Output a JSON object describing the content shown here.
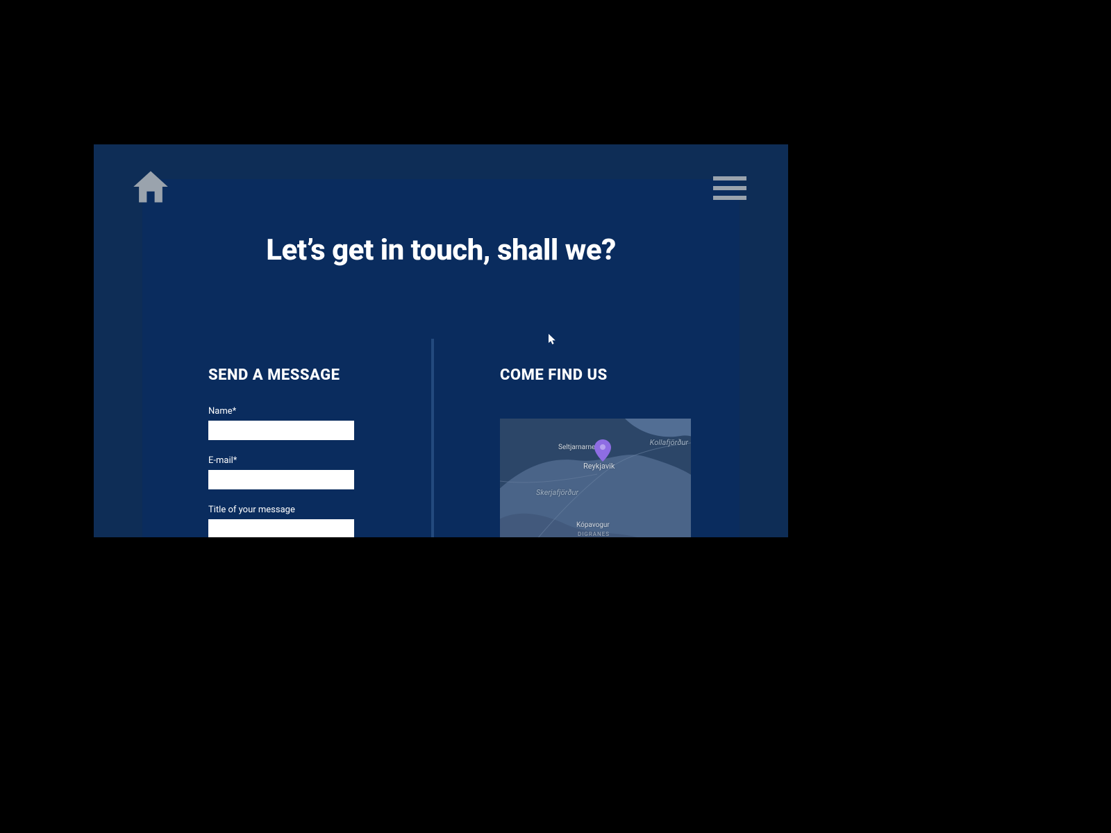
{
  "header": {
    "home_icon": "home-icon",
    "menu_icon": "hamburger-icon"
  },
  "page": {
    "title": "Let’s get in touch, shall we?"
  },
  "left": {
    "heading": "SEND A MESSAGE",
    "fields": {
      "name_label": "Name*",
      "name_value": "",
      "email_label": "E-mail*",
      "email_value": "",
      "title_label": "Title of your message",
      "title_value": ""
    }
  },
  "right": {
    "heading": "COME FIND US"
  },
  "map": {
    "pin_city": "Reykjavik",
    "labels": {
      "seltjarnarnes": "Seltjarnarnes",
      "kollafjordur": "Kollafjörður",
      "skerjafjordur": "Skerjafjörður",
      "kopavogur": "Kópavogur",
      "digranes": "DIGRANES"
    }
  },
  "colors": {
    "outer_bg": "#0e2d56",
    "inner_bg": "#0a2c5e",
    "divider": "#234a7e",
    "icon_gray": "#9aa3ad",
    "pin": "#8e6de3",
    "map_water": "#2c4668",
    "map_land": "#4a6488"
  }
}
